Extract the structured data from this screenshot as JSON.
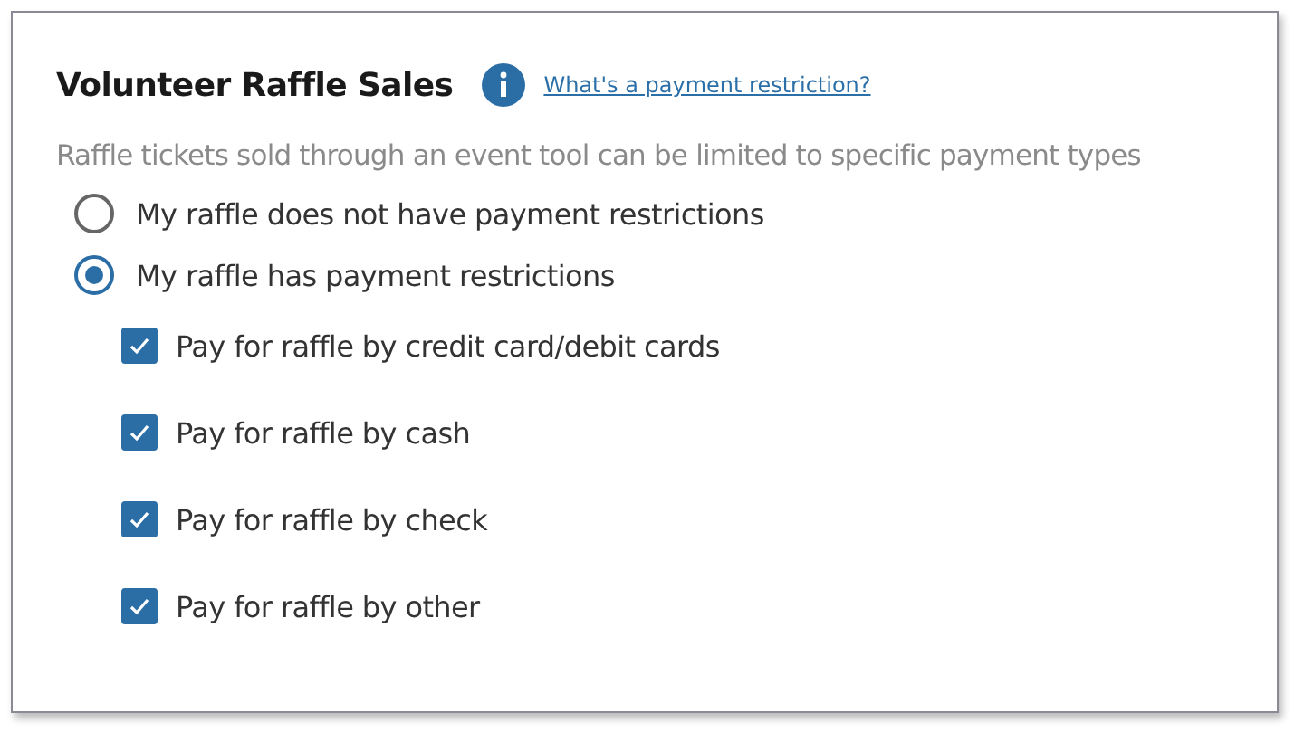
{
  "section": {
    "title": "Volunteer Raffle Sales",
    "help_link": "What's a payment restriction?",
    "description": "Raffle tickets sold through an event tool can be limited to specific payment types"
  },
  "radios": [
    {
      "label": "My raffle does not have payment restrictions",
      "selected": false
    },
    {
      "label": "My raffle has payment restrictions",
      "selected": true
    }
  ],
  "checkboxes": [
    {
      "label": "Pay for raffle by credit card/debit cards",
      "checked": true
    },
    {
      "label": "Pay for raffle by cash",
      "checked": true
    },
    {
      "label": "Pay for raffle by check",
      "checked": true
    },
    {
      "label": "Pay for raffle by other",
      "checked": true
    }
  ]
}
